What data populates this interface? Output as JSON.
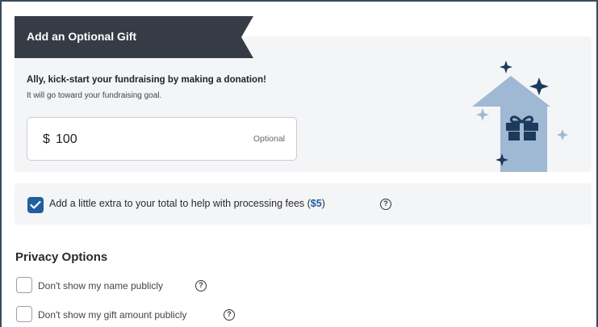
{
  "gift": {
    "tab_title": "Add an Optional Gift",
    "heading": "Ally, kick-start your fundraising by making a donation!",
    "subtext": "It will go toward your fundraising goal.",
    "currency": "$",
    "amount": "100",
    "optional_label": "Optional"
  },
  "fees": {
    "checked": true,
    "label_prefix": "Add a little extra to your total to help with processing fees (",
    "amount": "$5",
    "label_suffix": ")",
    "help_glyph": "?"
  },
  "privacy": {
    "title": "Privacy Options",
    "options": [
      {
        "label": "Don't show my name publicly",
        "checked": false,
        "help_glyph": "?"
      },
      {
        "label": "Don't show my gift amount publicly",
        "checked": false,
        "help_glyph": "?"
      }
    ]
  },
  "colors": {
    "tab_bg": "#353c45",
    "accent": "#1f5f9e",
    "panel_bg": "#f4f5f7",
    "illustration_arrow": "#9fb8d3",
    "illustration_dark": "#1b3a5c"
  },
  "icons": {
    "gift_illustration": "gift-arrow-illustration",
    "checkbox_check": "check-icon",
    "help": "question-circle-icon"
  }
}
